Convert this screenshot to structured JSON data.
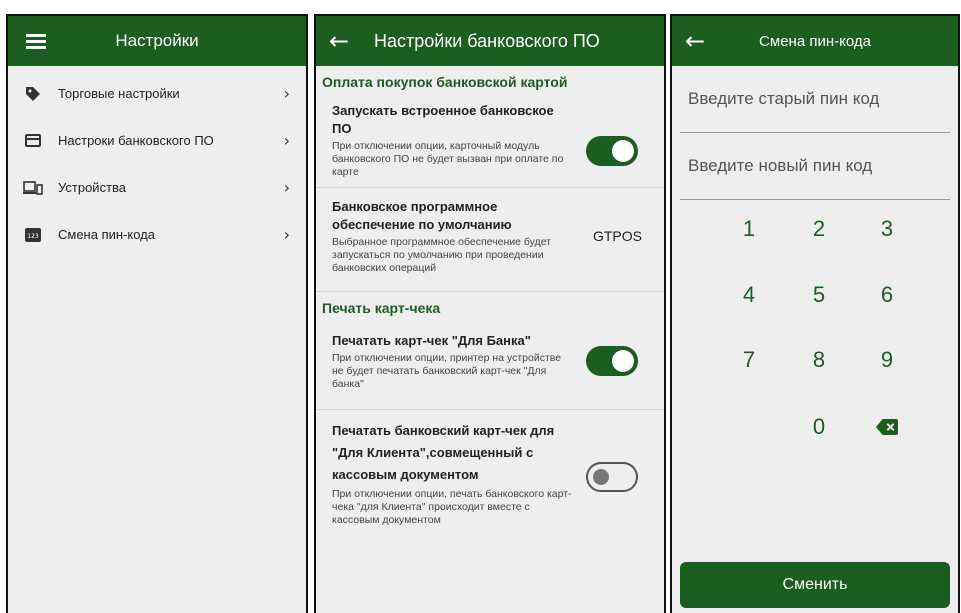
{
  "colors": {
    "primary": "#1b5e20",
    "background": "#eeeeee"
  },
  "settings_menu": {
    "title": "Настройки",
    "items": [
      {
        "label": "Торговые настройки",
        "icon": "tag-icon"
      },
      {
        "label": "Настроки банковского ПО",
        "icon": "card-icon"
      },
      {
        "label": "Устройства",
        "icon": "devices-icon"
      },
      {
        "label": "Смена пин-кода",
        "icon": "pin-123-icon"
      }
    ]
  },
  "bank_settings": {
    "title": "Настройки банковского ПО",
    "section_payment": "Оплата покупок банковской картой",
    "builtin_title": "Запускать встроенное банковское ПО",
    "builtin_desc": "При отключении опции, карточный модуль банковского ПО не будет вызван при оплате по карте",
    "builtin_enabled": true,
    "default_title": "Банковское программное обеспечение по умолчанию",
    "default_desc": "Выбранное программное обеспечение будет запускаться по умолчанию при проведении банковских операций",
    "default_value": "GTPOS",
    "section_print": "Печать карт-чека",
    "print_bank_title": "Печатать карт-чек \"Для Банка\"",
    "print_bank_desc": "При отключении опции, принтер на устройстве не будет печатать банковский карт-чек \"Для банка\"",
    "print_bank_enabled": true,
    "print_client_title": "Печатать банковский карт-чек для \"Для Клиента\",совмещенный с кассовым документом",
    "print_client_desc": "При отключении опции, печать банковского карт-чека \"для Клиента\" происходит вместе с кассовым документом",
    "print_client_enabled": false
  },
  "pin_change": {
    "title": "Смена пин-кода",
    "old_pin_placeholder": "Введите старый пин код",
    "new_pin_placeholder": "Введите новый пин код",
    "keys": [
      "1",
      "2",
      "3",
      "4",
      "5",
      "6",
      "7",
      "8",
      "9",
      "0"
    ],
    "submit_label": "Сменить"
  }
}
